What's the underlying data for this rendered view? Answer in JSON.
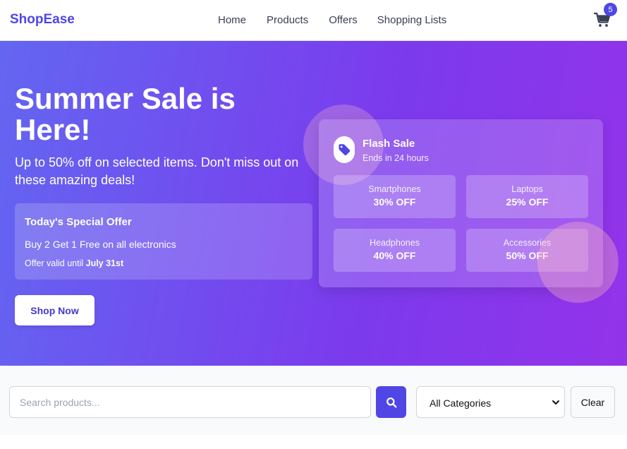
{
  "navbar": {
    "brand": "ShopEase",
    "links": [
      "Home",
      "Products",
      "Offers",
      "Shopping Lists"
    ],
    "cart_icon": "cart-icon",
    "cart_count": "5"
  },
  "hero": {
    "title": "Summer Sale is Here!",
    "subtitle": "Up to 50% off on selected items. Don't miss out on these amazing deals!",
    "special_offer": {
      "title": "Today's Special Offer",
      "description": "Buy 2 Get 1 Free on all electronics",
      "valid_prefix": "Offer valid until ",
      "valid_date": "July 31st"
    },
    "cta_label": "Shop Now"
  },
  "flash_sale": {
    "icon": "tag-icon",
    "title": "Flash Sale",
    "ends": "Ends in 24 hours",
    "tiles": [
      {
        "name": "Smartphones",
        "discount": "30% OFF"
      },
      {
        "name": "Laptops",
        "discount": "25% OFF"
      },
      {
        "name": "Headphones",
        "discount": "40% OFF"
      },
      {
        "name": "Accessories",
        "discount": "50% OFF"
      }
    ]
  },
  "filters": {
    "search_placeholder": "Search products...",
    "search_icon": "search-icon",
    "category_selected": "All Categories",
    "clear_label": "Clear"
  },
  "colors": {
    "brand": "#4f46e5",
    "hero_gradient_start": "#6366f1",
    "hero_gradient_end": "#9333ea"
  }
}
